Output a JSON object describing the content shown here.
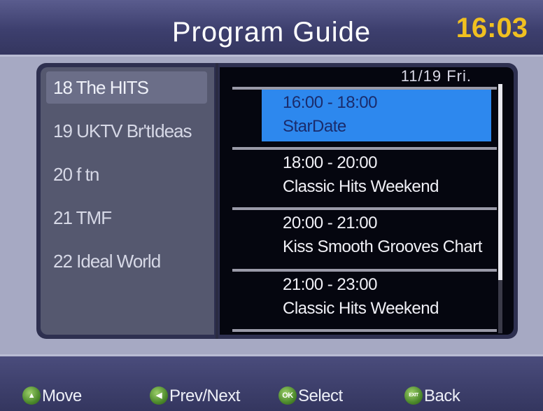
{
  "header": {
    "title": "Program Guide",
    "clock": "16:03"
  },
  "channels": [
    {
      "label": "18 The HITS",
      "selected": true
    },
    {
      "label": "19 UKTV Br'tIdeas",
      "selected": false
    },
    {
      "label": "20 f tn",
      "selected": false
    },
    {
      "label": "21 TMF",
      "selected": false
    },
    {
      "label": "22 Ideal World",
      "selected": false
    }
  ],
  "schedule": {
    "date": "11/19  Fri.",
    "programs": [
      {
        "time": "16:00 - 18:00",
        "name": "StarDate",
        "selected": true
      },
      {
        "time": "18:00 - 20:00",
        "name": "Classic Hits Weekend",
        "selected": false
      },
      {
        "time": "20:00 - 21:00",
        "name": "Kiss Smooth Grooves Chart",
        "selected": false
      },
      {
        "time": "21:00 - 23:00",
        "name": "Classic Hits Weekend",
        "selected": false
      }
    ]
  },
  "footer": {
    "move": "Move",
    "prev_next": "Prev/Next",
    "select": "Select",
    "select_icon": "OK",
    "back": "Back",
    "back_icon": "EXIT"
  },
  "colors": {
    "accent_selected": "#2d88ee",
    "clock": "#f0c020",
    "button_icon": "#4d8a2c"
  }
}
